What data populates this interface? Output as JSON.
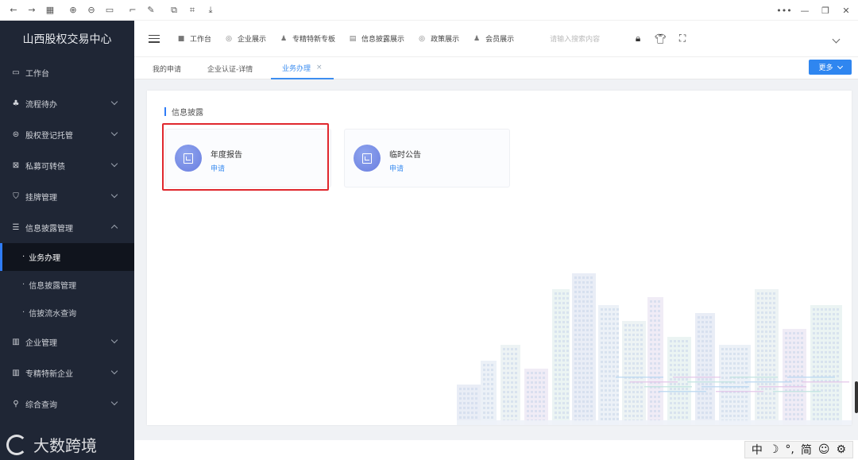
{
  "browser": {
    "icons": [
      "back-icon",
      "forward-icon",
      "apps-icon",
      "zoom-in-icon",
      "zoom-out-icon",
      "fit-icon",
      "crop-icon",
      "edit-icon",
      "copy-icon",
      "screenshot-icon",
      "download-icon"
    ],
    "icon_glyphs": [
      "←",
      "→",
      "▦",
      "⊕",
      "⊖",
      "▭",
      "⌐",
      "✎",
      "⧉",
      "⌗",
      "⤓"
    ],
    "right_glyphs": [
      "•••",
      "—",
      "❐",
      "✕"
    ]
  },
  "sidebar": {
    "brand": "山西股权交易中心",
    "items": [
      {
        "label": "工作台",
        "glyph": "▭",
        "chevron": false
      },
      {
        "label": "流程待办",
        "glyph": "♣",
        "chevron": true
      },
      {
        "label": "股权登记托管",
        "glyph": "⊜",
        "chevron": true
      },
      {
        "label": "私募可转债",
        "glyph": "⊠",
        "chevron": true
      },
      {
        "label": "挂牌管理",
        "glyph": "⛉",
        "chevron": true
      },
      {
        "label": "信息披露管理",
        "glyph": "☰",
        "chevron": true,
        "expanded": true
      }
    ],
    "sub_items": [
      {
        "label": "业务办理",
        "active": true
      },
      {
        "label": "信息披露管理",
        "active": false
      },
      {
        "label": "信披流水查询",
        "active": false
      }
    ],
    "items_after": [
      {
        "label": "企业管理",
        "glyph": "▥",
        "chevron": true
      },
      {
        "label": "专精特新企业",
        "glyph": "▥",
        "chevron": true
      },
      {
        "label": "综合查询",
        "glyph": "⚲",
        "chevron": true
      }
    ]
  },
  "topbar": {
    "nav": [
      {
        "label": "工作台",
        "glyph": "■"
      },
      {
        "label": "企业展示",
        "glyph": "◎"
      },
      {
        "label": "专精特新专板",
        "glyph": "♟"
      },
      {
        "label": "信息披露展示",
        "glyph": "▤"
      },
      {
        "label": "政策展示",
        "glyph": "◎"
      },
      {
        "label": "会员展示",
        "glyph": "♟"
      }
    ],
    "search_placeholder": "请输入搜索内容",
    "right_icons": [
      {
        "name": "lock-icon",
        "glyph": "🔒︎"
      },
      {
        "name": "shirt-icon",
        "glyph": "👕︎"
      },
      {
        "name": "fullscreen-icon",
        "glyph": "⛶"
      }
    ]
  },
  "tabs": {
    "items": [
      {
        "label": "我的申请",
        "active": false
      },
      {
        "label": "企业认证-详情",
        "active": false
      },
      {
        "label": "业务办理",
        "active": true,
        "closable": true
      }
    ],
    "close_glyph": "×",
    "more_label": "更多"
  },
  "main": {
    "section_title": "信息披露",
    "cards": [
      {
        "title": "年度报告",
        "action": "申请"
      },
      {
        "title": "临时公告",
        "action": "申请"
      }
    ]
  },
  "ime": [
    "中",
    "☽",
    "°,",
    "简",
    "☺",
    "⚙"
  ],
  "watermark": {
    "text": "大数跨境"
  },
  "colors": {
    "sidebar_bg": "#1f2635",
    "accent": "#2f86f0",
    "highlight": "#e0282e"
  }
}
